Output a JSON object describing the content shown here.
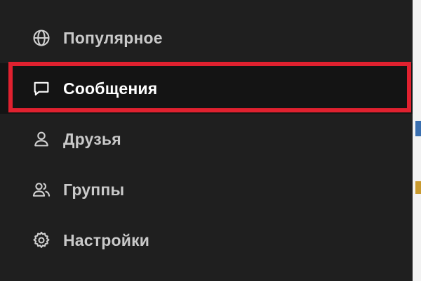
{
  "menu": {
    "items": [
      {
        "label": "Популярное",
        "icon": "globe-icon"
      },
      {
        "label": "Сообщения",
        "icon": "message-icon"
      },
      {
        "label": "Друзья",
        "icon": "user-icon"
      },
      {
        "label": "Группы",
        "icon": "group-icon"
      },
      {
        "label": "Настройки",
        "icon": "gear-icon"
      }
    ],
    "active_index": 1
  },
  "colors": {
    "background": "#1f1f1f",
    "active_background": "#141414",
    "highlight_border": "#e0212f",
    "text": "#c9c9c9",
    "active_text": "#ffffff"
  }
}
